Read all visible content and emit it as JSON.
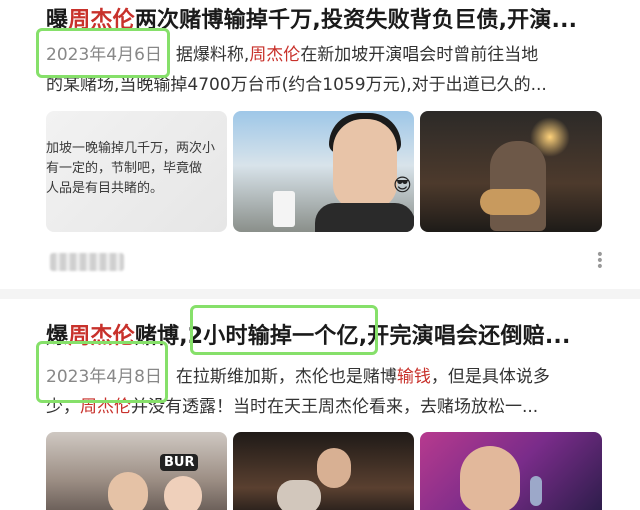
{
  "result1": {
    "title_prefix": "曝",
    "title_name": "周杰伦",
    "title_rest": "两次赌博输掉千万,投资失败背负巨债,开演...",
    "date": "2023年4月6日",
    "snippet_a": "据爆料称,",
    "snippet_name": "周杰伦",
    "snippet_b": "在新加坡开演唱会时曾前往当地",
    "snippet_line2": "的某赌场,当晚输掉4700万台币(约合1059万元),对于出道已久的...",
    "thumb1_text": "加坡一晚输掉几千万，两次小\n有一定的，节制吧，毕竟做\n人品是有目共睹的。",
    "thumb2_emoji": "😎",
    "more_icon": "⋮"
  },
  "result2": {
    "title_prefix": "爆",
    "title_name": "周杰伦",
    "title_mid": "赌博,",
    "title_boxed": "2小时输掉一个亿",
    "title_rest": ",开完演唱会还倒赔...",
    "date": "2023年4月8日",
    "snippet_a": "在拉斯维加斯，杰伦也是赌博",
    "snippet_kw": "输钱",
    "snippet_b": "，但是具体说多",
    "snippet_line2_a": "少，",
    "snippet_name": "周杰伦",
    "snippet_line2_b": "并没有透露！当时在天王周杰伦看来，去赌场放松一...",
    "thumb1_cap": "BUR"
  },
  "colors": {
    "highlight": "#c8312b",
    "annotation_box": "#86e06a",
    "date_text": "#888888"
  }
}
